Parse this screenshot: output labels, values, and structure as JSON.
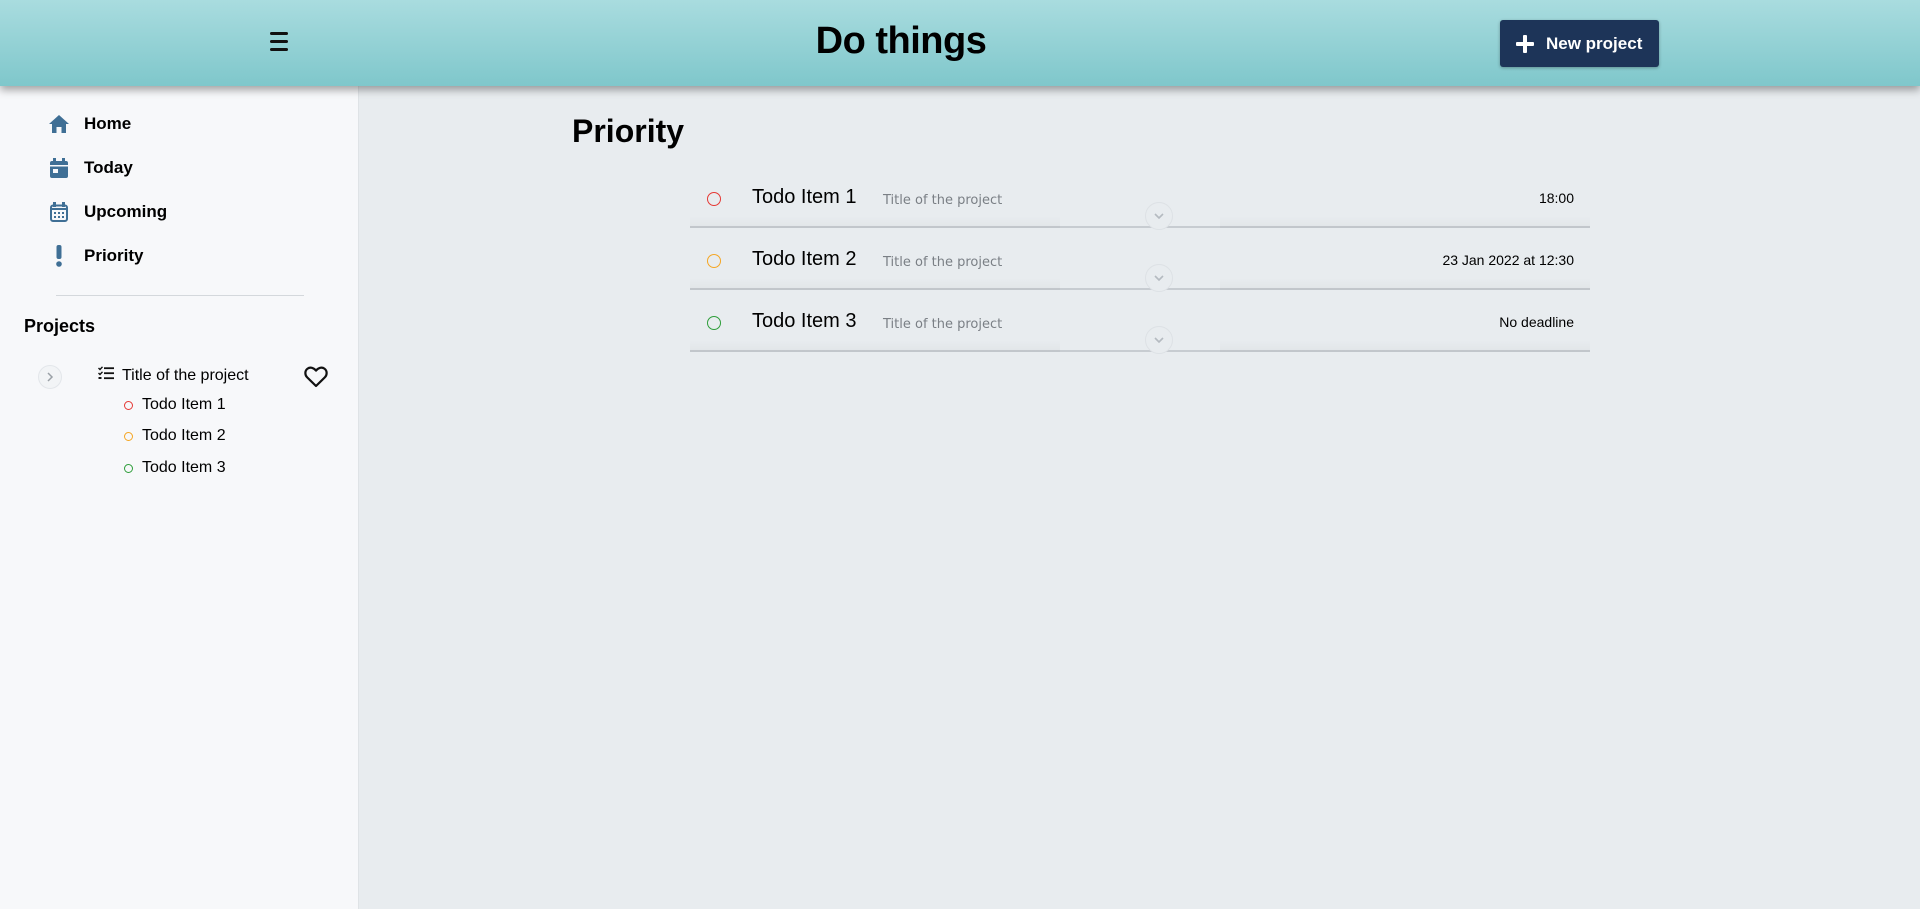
{
  "header": {
    "app_title": "Do things",
    "menu_icon": "hamburger-icon",
    "new_project_label": "New project",
    "new_project_icon": "plus-icon"
  },
  "sidebar": {
    "nav": [
      {
        "label": "Home",
        "icon": "home-icon"
      },
      {
        "label": "Today",
        "icon": "calendar-icon"
      },
      {
        "label": "Upcoming",
        "icon": "calendar-grid-icon"
      },
      {
        "label": "Priority",
        "icon": "exclamation-icon"
      }
    ],
    "projects_heading": "Projects",
    "project": {
      "title": "Title of the project",
      "icon": "checklist-icon",
      "favorite_icon": "heart-icon",
      "items": [
        {
          "label": "Todo Item 1",
          "color": "#e53935"
        },
        {
          "label": "Todo Item 2",
          "color": "#f5a623"
        },
        {
          "label": "Todo Item 3",
          "color": "#2e9e3a"
        }
      ]
    }
  },
  "main": {
    "title": "Priority",
    "todos": [
      {
        "name": "Todo Item 1",
        "project": "Title of the project",
        "deadline": "18:00",
        "color": "#e53935"
      },
      {
        "name": "Todo Item 2",
        "project": "Title of the project",
        "deadline": "23 Jan 2022 at 12:30",
        "color": "#f5a623"
      },
      {
        "name": "Todo Item 3",
        "project": "Title of the project",
        "deadline": "No deadline",
        "color": "#2e9e3a"
      }
    ]
  },
  "colors": {
    "accent_dark": "#1d3458",
    "header_gradient_top": "#a9dcdf",
    "header_gradient_bottom": "#7fc7cb",
    "nav_icon": "#3f6f95"
  }
}
